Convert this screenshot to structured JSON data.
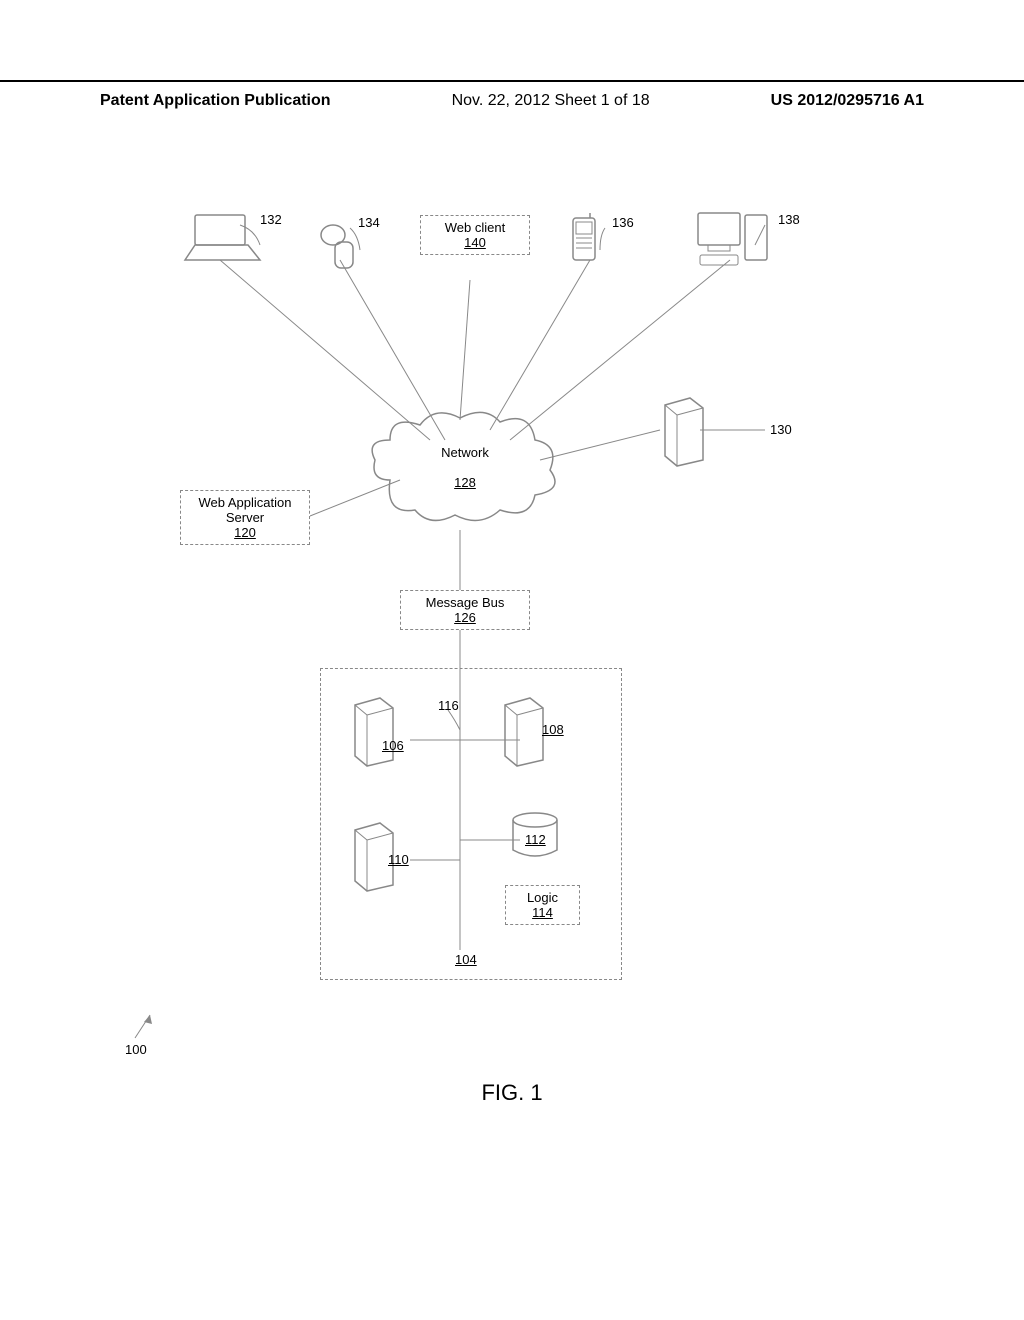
{
  "header": {
    "left": "Patent Application Publication",
    "center": "Nov. 22, 2012   Sheet 1 of 18",
    "right": "US 2012/0295716 A1"
  },
  "diagram": {
    "webclient": {
      "title": "Web client",
      "num": "140"
    },
    "network": {
      "title": "Network",
      "num": "128"
    },
    "webapp": {
      "title": "Web Application Server",
      "num": "120"
    },
    "msgbus": {
      "title": "Message Bus",
      "num": "126"
    },
    "logic": {
      "title": "Logic",
      "num": "114"
    },
    "refs": {
      "r132": "132",
      "r134": "134",
      "r136": "136",
      "r138": "138",
      "r130": "130",
      "r116": "116",
      "r106": "106",
      "r108": "108",
      "r110": "110",
      "r112": "112",
      "r104": "104",
      "r100": "100"
    }
  },
  "figure_label": "FIG. 1"
}
